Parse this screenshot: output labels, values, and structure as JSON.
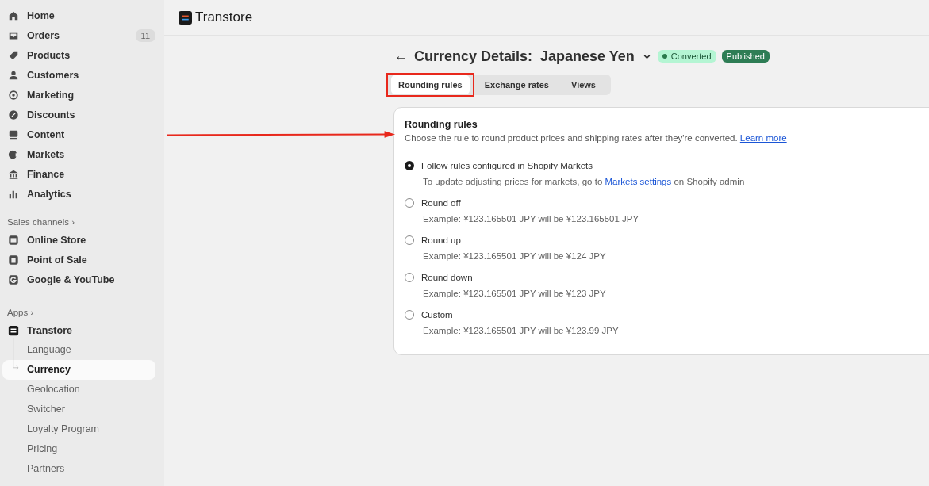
{
  "sidebar": {
    "nav": [
      {
        "label": "Home"
      },
      {
        "label": "Orders",
        "badge": "11"
      },
      {
        "label": "Products"
      },
      {
        "label": "Customers"
      },
      {
        "label": "Marketing"
      },
      {
        "label": "Discounts"
      },
      {
        "label": "Content"
      },
      {
        "label": "Markets"
      },
      {
        "label": "Finance"
      },
      {
        "label": "Analytics"
      }
    ],
    "sales_channels": {
      "heading": "Sales channels",
      "chevron": "›",
      "items": [
        "Online Store",
        "Point of Sale",
        "Google & YouTube"
      ]
    },
    "apps": {
      "heading": "Apps",
      "chevron": "›",
      "app": "Transtore",
      "children": [
        {
          "label": "Language",
          "selected": false
        },
        {
          "label": "Currency",
          "selected": true
        },
        {
          "label": "Geolocation",
          "selected": false
        },
        {
          "label": "Switcher",
          "selected": false
        },
        {
          "label": "Loyalty Program",
          "selected": false
        },
        {
          "label": "Pricing",
          "selected": false
        },
        {
          "label": "Partners",
          "selected": false
        }
      ]
    }
  },
  "header": {
    "app_name": "Transtore"
  },
  "page": {
    "back": "←",
    "title": "Currency Details:  Japanese Yen",
    "badges": [
      {
        "label": "Converted",
        "kind": "status"
      },
      {
        "label": "Published",
        "kind": "solid"
      }
    ],
    "tabs": [
      {
        "label": "Rounding rules",
        "selected": true,
        "highlighted": true
      },
      {
        "label": "Exchange rates",
        "selected": false,
        "highlighted": false
      },
      {
        "label": "Views",
        "selected": false,
        "highlighted": false
      }
    ],
    "annotation_arrow": true,
    "card": {
      "title": "Rounding rules",
      "subtitle": "Choose the rule to round product prices and shipping rates after they're converted.",
      "subtitle_link": "Learn more",
      "options": [
        {
          "label": "Follow rules configured in Shopify Markets",
          "selected": true,
          "description": "To update adjusting prices for markets, go to",
          "link": "Markets settings",
          "description_after": "on Shopify admin"
        },
        {
          "label": "Round off",
          "selected": false,
          "description": "Example: ¥123.165501 JPY  will be ¥123.165501 JPY"
        },
        {
          "label": "Round up",
          "selected": false,
          "description": "Example: ¥123.165501 JPY  will be ¥124 JPY"
        },
        {
          "label": "Round down",
          "selected": false,
          "description": "Example: ¥123.165501 JPY  will be ¥123 JPY"
        },
        {
          "label": "Custom",
          "selected": false,
          "description": "Example: ¥123.165501 JPY  will be ¥123.99 JPY"
        }
      ]
    }
  }
}
